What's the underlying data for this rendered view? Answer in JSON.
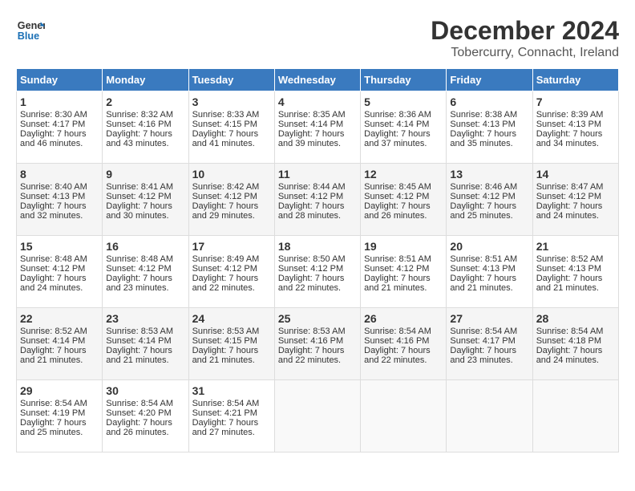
{
  "header": {
    "logo_line1": "General",
    "logo_line2": "Blue",
    "title": "December 2024",
    "subtitle": "Tobercurry, Connacht, Ireland"
  },
  "days_of_week": [
    "Sunday",
    "Monday",
    "Tuesday",
    "Wednesday",
    "Thursday",
    "Friday",
    "Saturday"
  ],
  "weeks": [
    [
      {
        "day": 1,
        "sunrise": "8:30 AM",
        "sunset": "4:17 PM",
        "daylight": "7 hours and 46 minutes."
      },
      {
        "day": 2,
        "sunrise": "8:32 AM",
        "sunset": "4:16 PM",
        "daylight": "7 hours and 43 minutes."
      },
      {
        "day": 3,
        "sunrise": "8:33 AM",
        "sunset": "4:15 PM",
        "daylight": "7 hours and 41 minutes."
      },
      {
        "day": 4,
        "sunrise": "8:35 AM",
        "sunset": "4:14 PM",
        "daylight": "7 hours and 39 minutes."
      },
      {
        "day": 5,
        "sunrise": "8:36 AM",
        "sunset": "4:14 PM",
        "daylight": "7 hours and 37 minutes."
      },
      {
        "day": 6,
        "sunrise": "8:38 AM",
        "sunset": "4:13 PM",
        "daylight": "7 hours and 35 minutes."
      },
      {
        "day": 7,
        "sunrise": "8:39 AM",
        "sunset": "4:13 PM",
        "daylight": "7 hours and 34 minutes."
      }
    ],
    [
      {
        "day": 8,
        "sunrise": "8:40 AM",
        "sunset": "4:13 PM",
        "daylight": "7 hours and 32 minutes."
      },
      {
        "day": 9,
        "sunrise": "8:41 AM",
        "sunset": "4:12 PM",
        "daylight": "7 hours and 30 minutes."
      },
      {
        "day": 10,
        "sunrise": "8:42 AM",
        "sunset": "4:12 PM",
        "daylight": "7 hours and 29 minutes."
      },
      {
        "day": 11,
        "sunrise": "8:44 AM",
        "sunset": "4:12 PM",
        "daylight": "7 hours and 28 minutes."
      },
      {
        "day": 12,
        "sunrise": "8:45 AM",
        "sunset": "4:12 PM",
        "daylight": "7 hours and 26 minutes."
      },
      {
        "day": 13,
        "sunrise": "8:46 AM",
        "sunset": "4:12 PM",
        "daylight": "7 hours and 25 minutes."
      },
      {
        "day": 14,
        "sunrise": "8:47 AM",
        "sunset": "4:12 PM",
        "daylight": "7 hours and 24 minutes."
      }
    ],
    [
      {
        "day": 15,
        "sunrise": "8:48 AM",
        "sunset": "4:12 PM",
        "daylight": "7 hours and 24 minutes."
      },
      {
        "day": 16,
        "sunrise": "8:48 AM",
        "sunset": "4:12 PM",
        "daylight": "7 hours and 23 minutes."
      },
      {
        "day": 17,
        "sunrise": "8:49 AM",
        "sunset": "4:12 PM",
        "daylight": "7 hours and 22 minutes."
      },
      {
        "day": 18,
        "sunrise": "8:50 AM",
        "sunset": "4:12 PM",
        "daylight": "7 hours and 22 minutes."
      },
      {
        "day": 19,
        "sunrise": "8:51 AM",
        "sunset": "4:12 PM",
        "daylight": "7 hours and 21 minutes."
      },
      {
        "day": 20,
        "sunrise": "8:51 AM",
        "sunset": "4:13 PM",
        "daylight": "7 hours and 21 minutes."
      },
      {
        "day": 21,
        "sunrise": "8:52 AM",
        "sunset": "4:13 PM",
        "daylight": "7 hours and 21 minutes."
      }
    ],
    [
      {
        "day": 22,
        "sunrise": "8:52 AM",
        "sunset": "4:14 PM",
        "daylight": "7 hours and 21 minutes."
      },
      {
        "day": 23,
        "sunrise": "8:53 AM",
        "sunset": "4:14 PM",
        "daylight": "7 hours and 21 minutes."
      },
      {
        "day": 24,
        "sunrise": "8:53 AM",
        "sunset": "4:15 PM",
        "daylight": "7 hours and 21 minutes."
      },
      {
        "day": 25,
        "sunrise": "8:53 AM",
        "sunset": "4:16 PM",
        "daylight": "7 hours and 22 minutes."
      },
      {
        "day": 26,
        "sunrise": "8:54 AM",
        "sunset": "4:16 PM",
        "daylight": "7 hours and 22 minutes."
      },
      {
        "day": 27,
        "sunrise": "8:54 AM",
        "sunset": "4:17 PM",
        "daylight": "7 hours and 23 minutes."
      },
      {
        "day": 28,
        "sunrise": "8:54 AM",
        "sunset": "4:18 PM",
        "daylight": "7 hours and 24 minutes."
      }
    ],
    [
      {
        "day": 29,
        "sunrise": "8:54 AM",
        "sunset": "4:19 PM",
        "daylight": "7 hours and 25 minutes."
      },
      {
        "day": 30,
        "sunrise": "8:54 AM",
        "sunset": "4:20 PM",
        "daylight": "7 hours and 26 minutes."
      },
      {
        "day": 31,
        "sunrise": "8:54 AM",
        "sunset": "4:21 PM",
        "daylight": "7 hours and 27 minutes."
      },
      null,
      null,
      null,
      null
    ]
  ]
}
